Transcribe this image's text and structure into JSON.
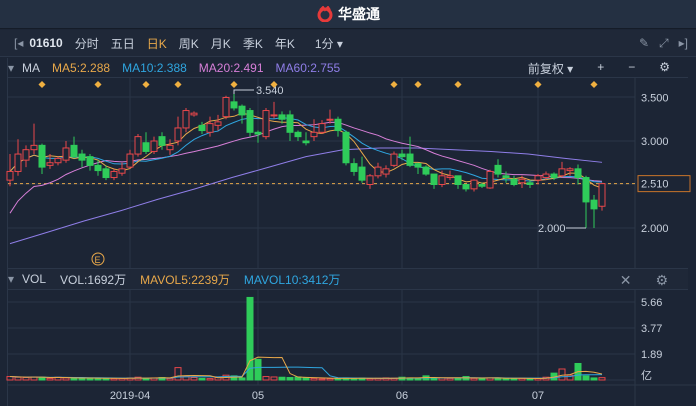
{
  "app": {
    "brand": "华盛通"
  },
  "toolbar": {
    "code": "01610",
    "periods": [
      "分时",
      "五日",
      "日K",
      "周K",
      "月K",
      "季K",
      "年K"
    ],
    "active": "日K",
    "minute": "1分 ▾"
  },
  "ma": {
    "label": "MA",
    "ma5": "MA5:2.288",
    "ma10": "MA10:2.388",
    "ma20": "MA20:2.491",
    "ma60": "MA60:2.755",
    "adjust": "前复权 ▾",
    "colors": {
      "ma5": "#e8a84a",
      "ma10": "#2fa6e0",
      "ma20": "#d77fd8",
      "ma60": "#8f7ee8"
    }
  },
  "price_axis": {
    "ticks": [
      3.5,
      3.0,
      2.0
    ],
    "tick_labels": [
      "3.500",
      "3.000",
      "2.000"
    ],
    "current": "2.510",
    "current_value": 2.51,
    "high_label": "3.540",
    "low_label": "2.000",
    "high": 3.54,
    "low": 2.0
  },
  "vol": {
    "label": "VOL",
    "vol": "VOL:1692万",
    "mavol5": "MAVOL5:2239万",
    "mavol10": "MAVOL10:3412万",
    "ticks": [
      5.66,
      3.77,
      1.89
    ],
    "tick_labels": [
      "5.66",
      "3.77",
      "1.89"
    ],
    "unit": "亿"
  },
  "dates": {
    "labels": [
      "2019-04",
      "05",
      "06",
      "07"
    ],
    "index": [
      15,
      31,
      49,
      66
    ]
  },
  "markers": {
    "diamonds": [
      4,
      11,
      17,
      21,
      28,
      33,
      48,
      51,
      56,
      66,
      73
    ],
    "event": {
      "label": "E",
      "index": 11
    }
  },
  "colors": {
    "up": "#e8474a",
    "down": "#2fcc5a"
  },
  "candles": [
    [
      2.55,
      2.65,
      2.85,
      2.48
    ],
    [
      2.65,
      2.85,
      3.02,
      2.6
    ],
    [
      2.78,
      2.9,
      2.95,
      2.7
    ],
    [
      2.9,
      2.95,
      3.2,
      2.85
    ],
    [
      2.95,
      2.7,
      2.97,
      2.62
    ],
    [
      2.72,
      2.75,
      2.85,
      2.68
    ],
    [
      2.75,
      2.8,
      2.82,
      2.72
    ],
    [
      2.78,
      2.92,
      3.0,
      2.75
    ],
    [
      2.95,
      2.82,
      3.05,
      2.8
    ],
    [
      2.85,
      2.78,
      2.9,
      2.7
    ],
    [
      2.82,
      2.72,
      2.85,
      2.66
    ],
    [
      2.72,
      2.66,
      2.78,
      2.6
    ],
    [
      2.68,
      2.58,
      2.72,
      2.55
    ],
    [
      2.58,
      2.65,
      2.68,
      2.55
    ],
    [
      2.63,
      2.68,
      2.75,
      2.6
    ],
    [
      2.7,
      2.85,
      2.9,
      2.68
    ],
    [
      2.85,
      3.05,
      3.08,
      2.82
    ],
    [
      2.98,
      2.88,
      3.1,
      2.85
    ],
    [
      2.88,
      3.0,
      3.05,
      2.85
    ],
    [
      3.05,
      2.95,
      3.1,
      2.9
    ],
    [
      2.9,
      2.95,
      3.02,
      2.84
    ],
    [
      3.0,
      3.15,
      3.28,
      2.95
    ],
    [
      3.15,
      3.35,
      3.38,
      3.1
    ],
    [
      3.3,
      3.32,
      3.34,
      3.28
    ],
    [
      3.18,
      3.12,
      3.22,
      3.08
    ],
    [
      3.1,
      3.2,
      3.28,
      3.05
    ],
    [
      3.18,
      3.22,
      3.3,
      3.12
    ],
    [
      3.28,
      3.5,
      3.52,
      3.25
    ],
    [
      3.45,
      3.38,
      3.54,
      3.35
    ],
    [
      3.4,
      3.3,
      3.42,
      3.2
    ],
    [
      3.35,
      3.1,
      3.38,
      3.05
    ],
    [
      3.1,
      3.08,
      3.12,
      2.98
    ],
    [
      3.05,
      3.35,
      3.38,
      3.02
    ],
    [
      3.3,
      3.3,
      3.45,
      3.26
    ],
    [
      3.3,
      3.25,
      3.34,
      3.2
    ],
    [
      3.3,
      3.1,
      3.35,
      3.0
    ],
    [
      3.1,
      3.05,
      3.12,
      3.0
    ],
    [
      3.0,
      2.98,
      3.1,
      2.95
    ],
    [
      3.05,
      3.1,
      3.25,
      3.0
    ],
    [
      3.1,
      3.2,
      3.24,
      3.08
    ],
    [
      3.25,
      3.25,
      3.36,
      3.2
    ],
    [
      3.25,
      3.12,
      3.28,
      3.05
    ],
    [
      3.1,
      2.75,
      3.12,
      2.72
    ],
    [
      2.74,
      2.65,
      2.8,
      2.6
    ],
    [
      2.7,
      2.55,
      2.82,
      2.52
    ],
    [
      2.5,
      2.6,
      2.62,
      2.45
    ],
    [
      2.6,
      2.7,
      2.75,
      2.57
    ],
    [
      2.62,
      2.68,
      2.72,
      2.58
    ],
    [
      2.72,
      2.85,
      2.88,
      2.7
    ],
    [
      2.85,
      2.82,
      2.9,
      2.78
    ],
    [
      2.85,
      2.72,
      3.05,
      2.7
    ],
    [
      2.74,
      2.7,
      2.75,
      2.62
    ],
    [
      2.7,
      2.62,
      2.72,
      2.6
    ],
    [
      2.62,
      2.5,
      2.62,
      2.45
    ],
    [
      2.5,
      2.6,
      2.66,
      2.47
    ],
    [
      2.58,
      2.6,
      2.66,
      2.55
    ],
    [
      2.6,
      2.5,
      2.6,
      2.45
    ],
    [
      2.5,
      2.45,
      2.5,
      2.42
    ],
    [
      2.45,
      2.55,
      2.56,
      2.42
    ],
    [
      2.5,
      2.48,
      2.52,
      2.46
    ],
    [
      2.46,
      2.65,
      2.67,
      2.45
    ],
    [
      2.72,
      2.62,
      2.79,
      2.58
    ],
    [
      2.6,
      2.58,
      2.65,
      2.52
    ],
    [
      2.56,
      2.5,
      2.6,
      2.48
    ],
    [
      2.52,
      2.56,
      2.6,
      2.46
    ],
    [
      2.52,
      2.5,
      2.55,
      2.46
    ],
    [
      2.55,
      2.6,
      2.62,
      2.5
    ],
    [
      2.58,
      2.62,
      2.65,
      2.55
    ],
    [
      2.62,
      2.58,
      2.64,
      2.55
    ],
    [
      2.6,
      2.68,
      2.76,
      2.58
    ],
    [
      2.66,
      2.68,
      2.7,
      2.6
    ],
    [
      2.68,
      2.58,
      2.73,
      2.5
    ],
    [
      2.58,
      2.3,
      2.6,
      2.0
    ],
    [
      2.32,
      2.22,
      2.38,
      2.0
    ],
    [
      2.25,
      2.51,
      2.52,
      2.2
    ]
  ],
  "volumes": [
    0.25,
    0.2,
    0.18,
    0.22,
    0.2,
    0.12,
    0.2,
    0.15,
    0.12,
    0.15,
    0.12,
    0.13,
    0.12,
    0.1,
    0.12,
    0.15,
    0.2,
    0.12,
    0.15,
    0.18,
    0.12,
    0.9,
    0.25,
    0.18,
    0.12,
    0.1,
    0.18,
    0.35,
    0.3,
    0.15,
    6.0,
    1.5,
    0.25,
    0.22,
    0.2,
    0.18,
    0.22,
    0.15,
    0.12,
    0.08,
    0.1,
    0.12,
    0.15,
    0.12,
    0.14,
    0.1,
    0.12,
    0.15,
    0.13,
    0.2,
    0.15,
    0.12,
    0.3,
    0.12,
    0.15,
    0.12,
    0.14,
    0.25,
    0.12,
    0.1,
    0.15,
    0.15,
    0.12,
    0.1,
    0.12,
    0.1,
    0.12,
    0.2,
    0.5,
    0.8,
    0.35,
    1.2,
    0.3,
    0.15,
    0.1692
  ],
  "ma60": [
    1.82,
    1.95,
    2.08,
    2.2,
    2.33,
    2.45,
    2.58,
    2.7,
    2.82,
    2.9,
    2.92,
    2.92,
    2.9,
    2.88,
    2.85,
    2.8,
    2.755
  ]
}
